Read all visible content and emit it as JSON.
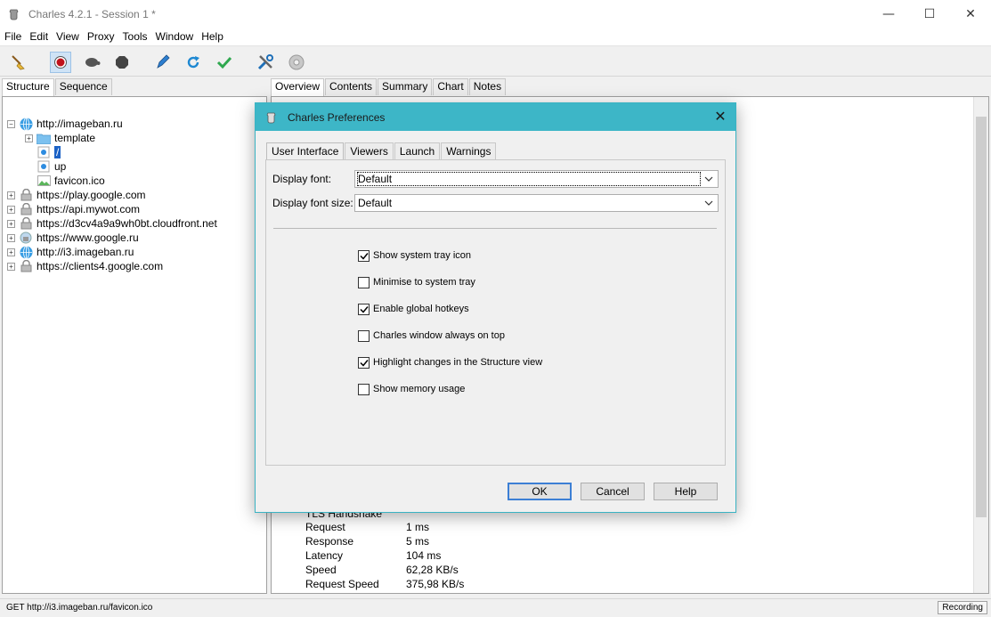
{
  "window": {
    "title": "Charles 4.2.1 - Session 1 *"
  },
  "menu": [
    "File",
    "Edit",
    "View",
    "Proxy",
    "Tools",
    "Window",
    "Help"
  ],
  "toolbar": [
    "broom-icon",
    "record-icon",
    "turtle-icon",
    "stop-icon",
    "pen-icon",
    "refresh-icon",
    "check-icon",
    "tools-icon",
    "gear-icon"
  ],
  "left_tabs": [
    "Structure",
    "Sequence"
  ],
  "tree": {
    "root": "http://imageban.ru",
    "children": [
      "template",
      "/",
      "up",
      "favicon.ico"
    ],
    "hosts": [
      "https://play.google.com",
      "https://api.mywot.com",
      "https://d3cv4a9a9wh0bt.cloudfront.net",
      "https://www.google.ru",
      "http://i3.imageban.ru",
      "https://clients4.google.com"
    ]
  },
  "right_tabs": [
    "Overview",
    "Contents",
    "Summary",
    "Chart",
    "Notes"
  ],
  "details": [
    {
      "k": "TLS Handshake",
      "v": ""
    },
    {
      "k": "Request",
      "v": "1 ms"
    },
    {
      "k": "Response",
      "v": "5 ms"
    },
    {
      "k": "Latency",
      "v": "104 ms"
    },
    {
      "k": "Speed",
      "v": "62,28 KB/s"
    },
    {
      "k": "Request Speed",
      "v": "375,98 KB/s"
    }
  ],
  "status": {
    "path": "GET http://i3.imageban.ru/favicon.ico",
    "recording": "Recording"
  },
  "dialog": {
    "title": "Charles Preferences",
    "tabs": [
      "User Interface",
      "Viewers",
      "Launch",
      "Warnings"
    ],
    "font_label": "Display font:",
    "font_value": "Default",
    "size_label": "Display font size:",
    "size_value": "Default",
    "options": [
      {
        "label": "Show system tray icon",
        "checked": true
      },
      {
        "label": "Minimise to system tray",
        "checked": false
      },
      {
        "label": "Enable global hotkeys",
        "checked": true
      },
      {
        "label": "Charles window always on top",
        "checked": false
      },
      {
        "label": "Highlight changes in the Structure view",
        "checked": true
      },
      {
        "label": "Show memory usage",
        "checked": false
      }
    ],
    "buttons": {
      "ok": "OK",
      "cancel": "Cancel",
      "help": "Help"
    }
  },
  "colors": {
    "accent": "#3db6c7",
    "selection": "#1b62c6"
  }
}
